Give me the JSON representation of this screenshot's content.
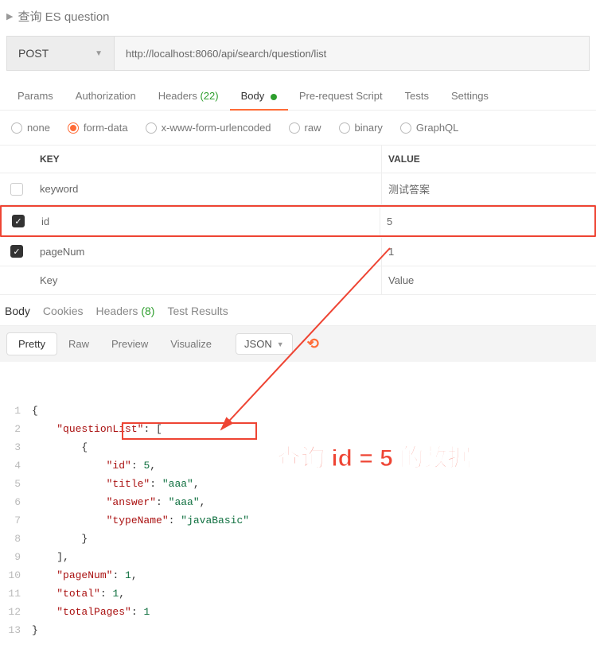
{
  "title": "查询 ES question",
  "method": "POST",
  "url": "http://localhost:8060/api/search/question/list",
  "tabs": {
    "params": "Params",
    "auth": "Authorization",
    "headers": "Headers",
    "headers_count": "(22)",
    "body": "Body",
    "prerequest": "Pre-request Script",
    "tests": "Tests",
    "settings": "Settings"
  },
  "body_types": {
    "none": "none",
    "form_data": "form-data",
    "urlencoded": "x-www-form-urlencoded",
    "raw": "raw",
    "binary": "binary",
    "graphql": "GraphQL"
  },
  "table": {
    "key_header": "KEY",
    "value_header": "VALUE",
    "rows": [
      {
        "enabled": false,
        "key": "keyword",
        "value": "测试答案",
        "highlight": false,
        "ph": false,
        "vph": true
      },
      {
        "enabled": true,
        "key": "id",
        "value": "5",
        "highlight": true,
        "ph": false,
        "vph": false
      },
      {
        "enabled": true,
        "key": "pageNum",
        "value": "1",
        "highlight": false,
        "ph": false,
        "vph": false
      }
    ],
    "placeholder_key": "Key",
    "placeholder_value": "Value"
  },
  "resp_tabs": {
    "body": "Body",
    "cookies": "Cookies",
    "headers": "Headers",
    "headers_count": "(8)",
    "test_results": "Test Results"
  },
  "viewbar": {
    "pretty": "Pretty",
    "raw": "Raw",
    "preview": "Preview",
    "visualize": "Visualize",
    "lang": "JSON"
  },
  "code_lines": [
    {
      "n": 1,
      "indent": 0,
      "t": "{"
    },
    {
      "n": 2,
      "indent": 1,
      "t": "\"questionList\": [",
      "key": "questionList"
    },
    {
      "n": 3,
      "indent": 2,
      "t": "{"
    },
    {
      "n": 4,
      "indent": 3,
      "t": "\"id\": 5,",
      "key": "id",
      "num": "5"
    },
    {
      "n": 5,
      "indent": 3,
      "t": "\"title\": \"aaa\",",
      "key": "title",
      "str": "aaa"
    },
    {
      "n": 6,
      "indent": 3,
      "t": "\"answer\": \"aaa\",",
      "key": "answer",
      "str": "aaa"
    },
    {
      "n": 7,
      "indent": 3,
      "t": "\"typeName\": \"javaBasic\"",
      "key": "typeName",
      "str": "javaBasic"
    },
    {
      "n": 8,
      "indent": 2,
      "t": "}"
    },
    {
      "n": 9,
      "indent": 1,
      "t": "],"
    },
    {
      "n": 10,
      "indent": 1,
      "t": "\"pageNum\": 1,",
      "key": "pageNum",
      "num": "1"
    },
    {
      "n": 11,
      "indent": 1,
      "t": "\"total\": 1,",
      "key": "total",
      "num": "1"
    },
    {
      "n": 12,
      "indent": 1,
      "t": "\"totalPages\": 1",
      "key": "totalPages",
      "num": "1"
    },
    {
      "n": 13,
      "indent": 0,
      "t": "}"
    }
  ],
  "annotation": "查询 id = 5 的数据"
}
